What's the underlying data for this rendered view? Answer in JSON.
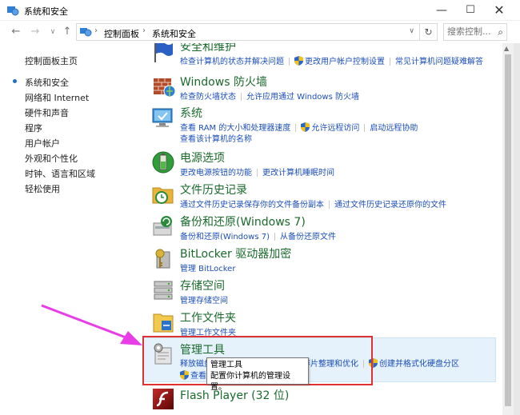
{
  "window": {
    "title": "系统和安全",
    "min_symbol": "—",
    "max_symbol": "☐",
    "close_symbol": "✕"
  },
  "nav": {
    "back_symbol": "←",
    "forward_symbol": "→",
    "history_symbol": "∨",
    "up_symbol": "↑",
    "breadcrumbs": [
      "控制面板",
      "系统和安全"
    ],
    "separator": "›",
    "refresh_symbol": "↻",
    "search_placeholder": "搜索控制...",
    "search_icon": "⌕"
  },
  "leftnav": {
    "items": [
      {
        "label": "控制面板主页"
      },
      {
        "label": "系统和安全"
      },
      {
        "label": "网络和 Internet"
      },
      {
        "label": "硬件和声音"
      },
      {
        "label": "程序"
      },
      {
        "label": "用户帐户"
      },
      {
        "label": "外观和个性化"
      },
      {
        "label": "时钟、语言和区域"
      },
      {
        "label": "轻松使用"
      }
    ]
  },
  "categories": [
    {
      "heading": "安全和维护",
      "links": [
        "检查计算机的状态并解决问题",
        "更改用户帐户控制设置",
        "常见计算机问题疑难解答"
      ],
      "shield": [
        false,
        true,
        false
      ]
    },
    {
      "heading": "Windows 防火墙",
      "links": [
        "检查防火墙状态",
        "允许应用通过 Windows 防火墙"
      ],
      "shield": [
        false,
        false
      ]
    },
    {
      "heading": "系统",
      "links": [
        "查看 RAM 的大小和处理器速度",
        "允许远程访问",
        "启动远程协助"
      ],
      "links2": [
        "查看该计算机的名称"
      ],
      "shield": [
        false,
        true,
        false
      ]
    },
    {
      "heading": "电源选项",
      "links": [
        "更改电源按钮的功能",
        "更改计算机睡眠时间"
      ],
      "shield": [
        false,
        false
      ]
    },
    {
      "heading": "文件历史记录",
      "links": [
        "通过文件历史记录保存你的文件备份副本",
        "通过文件历史记录还原你的文件"
      ],
      "shield": [
        false,
        false
      ]
    },
    {
      "heading": "备份和还原(Windows 7)",
      "links": [
        "备份和还原(Windows 7)",
        "从备份还原文件"
      ],
      "shield": [
        false,
        false
      ]
    },
    {
      "heading": "BitLocker 驱动器加密",
      "links": [
        "管理 BitLocker"
      ],
      "shield": [
        false
      ]
    },
    {
      "heading": "存储空间",
      "links": [
        "管理存储空间"
      ],
      "shield": [
        false
      ]
    },
    {
      "heading": "工作文件夹",
      "links": [
        "管理工作文件夹"
      ],
      "shield": [
        false
      ]
    },
    {
      "heading": "管理工具",
      "links": [
        "释放磁盘空间",
        "对你的驱动器进行碎片整理和优化",
        "创建并格式化硬盘分区"
      ],
      "links2": [
        "查看事件日志"
      ],
      "shield": [
        false,
        false,
        true
      ]
    },
    {
      "heading": "Flash Player (32 位)",
      "links": [],
      "shield": []
    }
  ],
  "tooltip": {
    "title": "管理工具",
    "text": "配置你计算机的管理设置。"
  },
  "colors": {
    "heading_green": "#1a6a2c",
    "link_blue": "#1c4fb8",
    "highlight_red": "#e03030",
    "arrow_magenta": "#e83ce6",
    "hover_bg": "#e5f1fb"
  }
}
